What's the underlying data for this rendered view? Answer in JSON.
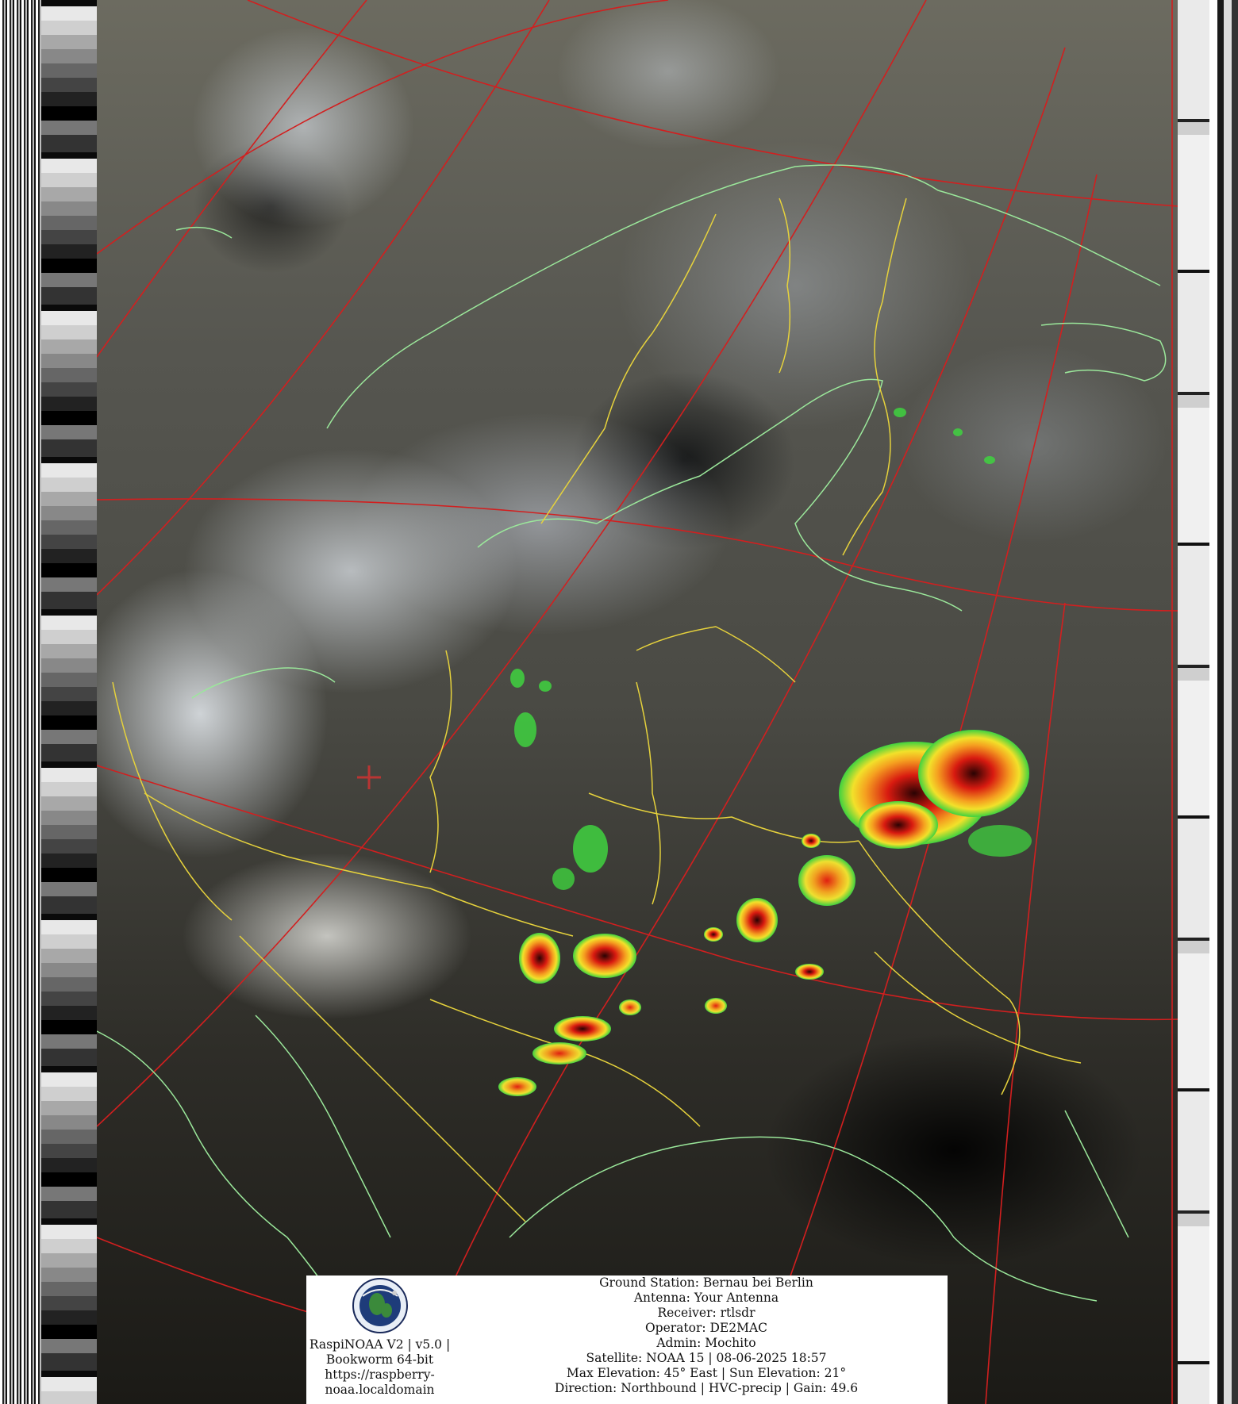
{
  "image": {
    "subject": "NOAA APT satellite image of Northern and Eastern Europe with HVC-precip overlay"
  },
  "overlay_colors": {
    "graticule": "#d21f1f",
    "coastline": "#9be89b",
    "borders": "#e6d23c",
    "precip_low": "#3fd23f",
    "precip_mid": "#f2e12a",
    "precip_high": "#d81a10",
    "precip_extreme": "#2a0303"
  },
  "info": {
    "station_lines": [
      "RaspiNOAA V2 | v5.0 |",
      "Bookworm 64-bit",
      "https://raspberry-",
      "noaa.localdomain"
    ],
    "pass_lines": [
      "Ground Station: Bernau bei Berlin",
      "Antenna: Your Antenna",
      "Receiver: rtlsdr",
      "Operator: DE2MAC",
      "Admin: Mochito",
      "Satellite: NOAA 15 | 08-06-2025 18:57",
      "Max Elevation: 45° East | Sun Elevation: 21°",
      "Direction: Northbound | HVC-precip | Gain: 49.6"
    ]
  }
}
